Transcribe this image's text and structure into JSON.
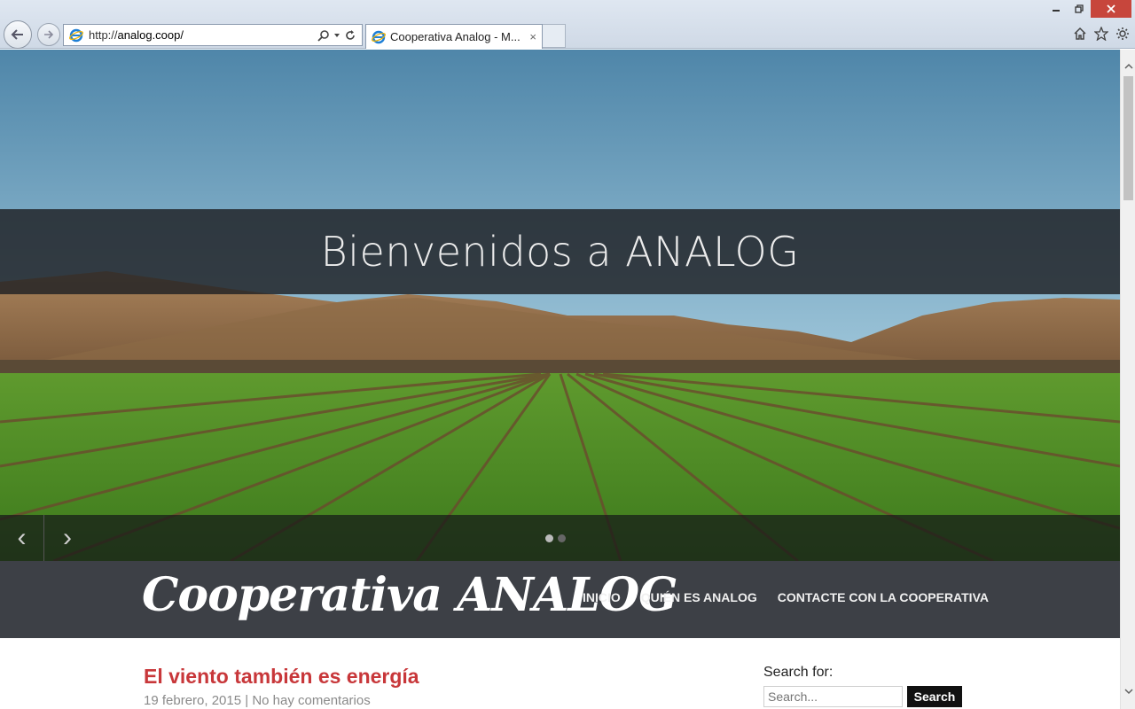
{
  "browser": {
    "url_prefix": "http://",
    "url_domain": "analog.coop/",
    "tab_title": "Cooperativa Analog - M...",
    "tab_close": "×",
    "window_controls": {
      "minimize": "🗕",
      "restore": "🗗",
      "close": "✕"
    },
    "icons": {
      "back": "back-arrow-icon",
      "forward": "forward-arrow-icon",
      "home": "home-icon",
      "favorites": "star-icon",
      "settings": "gear-icon"
    }
  },
  "hero": {
    "welcome": "Bienvenidos a ANALOG",
    "prev_arrow": "‹",
    "next_arrow": "›",
    "slides": 2,
    "active_slide": 1
  },
  "header": {
    "site_title": "Cooperativa ANALOG",
    "menu": [
      {
        "label": "INICIO"
      },
      {
        "label": "QUIÉN ES ANALOG"
      },
      {
        "label": "CONTACTE CON LA COOPERATIVA"
      }
    ]
  },
  "post": {
    "title": "El viento también es energía",
    "meta": "19 febrero, 2015 | No hay comentarios"
  },
  "sidebar": {
    "search_label": "Search for:",
    "search_placeholder": "Search...",
    "search_button": "Search"
  },
  "colors": {
    "post_title": "#c8373a",
    "header_band": "#2c3036",
    "search_button": "#111111"
  }
}
